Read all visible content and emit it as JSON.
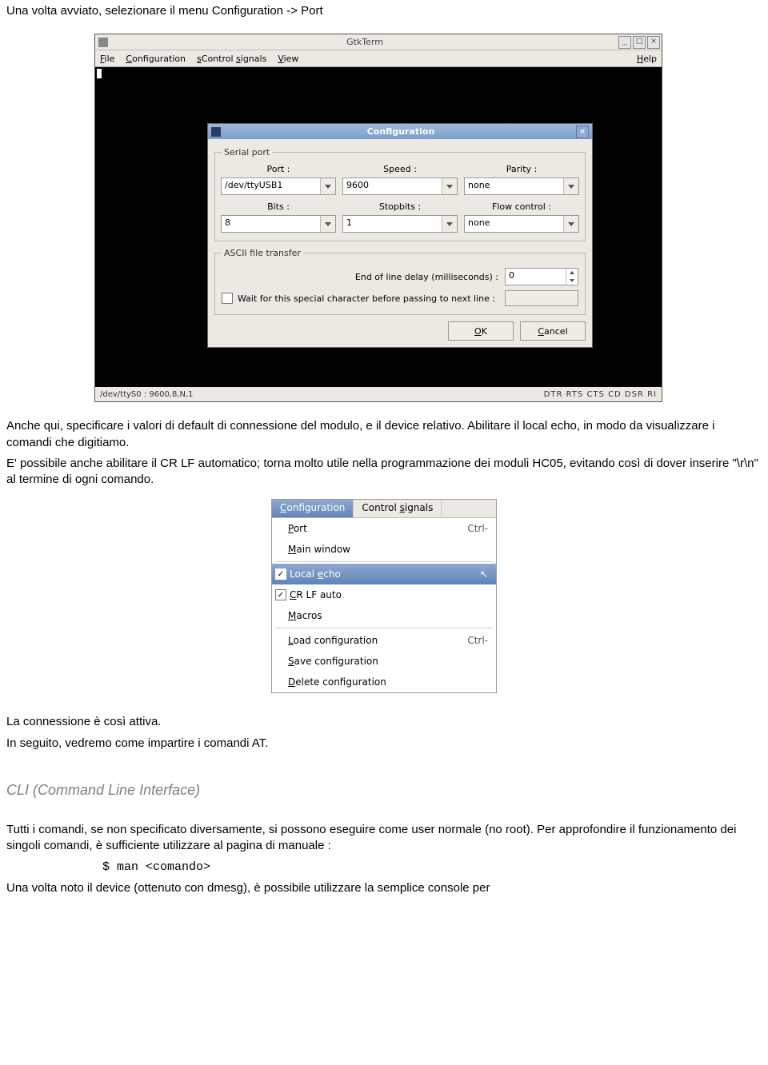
{
  "doc": {
    "intro": "Una volta avviato, selezionare il menu Configuration -> Port",
    "after_screenshot_1": "Anche qui, specificare i valori di default di connessione del modulo, e il device relativo. Abilitare il local echo, in modo da visualizzare i comandi che digitiamo.",
    "after_screenshot_2": "E' possibile anche abilitare il CR LF automatico; torna molto utile nella programmazione dei moduli HC05, evitando così di dover inserire \"\\r\\n\" al termine di ogni comando.",
    "after_menu_1": "La connessione è così attiva.",
    "after_menu_2": "In seguito, vedremo come impartire i comandi AT.",
    "section_cli": "CLI (Command Line Interface)",
    "cli_p1": "Tutti i comandi, se non specificato diversamente, si possono eseguire come user normale (no root). Per approfondire il funzionamento dei singoli comandi, è sufficiente utilizzare al pagina di manuale :",
    "cli_cmd": "$ man <comando>",
    "cli_p2": "Una volta noto il device (ottenuto con dmesg), è possibile utilizzare la semplice  console per"
  },
  "gtkterm": {
    "title": "GtkTerm",
    "menu": {
      "file": "File",
      "configuration": "Configuration",
      "control_signals": "Control signals",
      "view": "View",
      "help": "Help"
    },
    "status_left": "/dev/ttyS0 : 9600,8,N,1",
    "status_right": "DTR  RTS  CTS  CD  DSR  RI"
  },
  "cfg": {
    "title": "Configuration",
    "serial_port_legend": "Serial port",
    "labels": {
      "port": "Port :",
      "speed": "Speed :",
      "parity": "Parity :",
      "bits": "Bits :",
      "stopbits": "Stopbits :",
      "flow": "Flow control :"
    },
    "values": {
      "port": "/dev/ttyUSB1",
      "speed": "9600",
      "parity": "none",
      "bits": "8",
      "stopbits": "1",
      "flow": "none"
    },
    "ascii_legend": "ASCII file transfer",
    "ascii": {
      "delay_label": "End of line delay (milliseconds) :",
      "delay_value": "0",
      "wait_label": "Wait for this special character before passing to next line :"
    },
    "buttons": {
      "ok": "OK",
      "cancel": "Cancel"
    }
  },
  "menu_shot": {
    "tabs": {
      "configuration": "Configuration",
      "control_signals": "Control signals"
    },
    "items": {
      "port": "Port",
      "port_shortcut": "Ctrl-",
      "main_window": "Main window",
      "local_echo": "Local echo",
      "crlf": "CR LF auto",
      "macros": "Macros",
      "load": "Load configuration",
      "load_shortcut": "Ctrl-",
      "save": "Save configuration",
      "delete": "Delete configuration"
    }
  }
}
